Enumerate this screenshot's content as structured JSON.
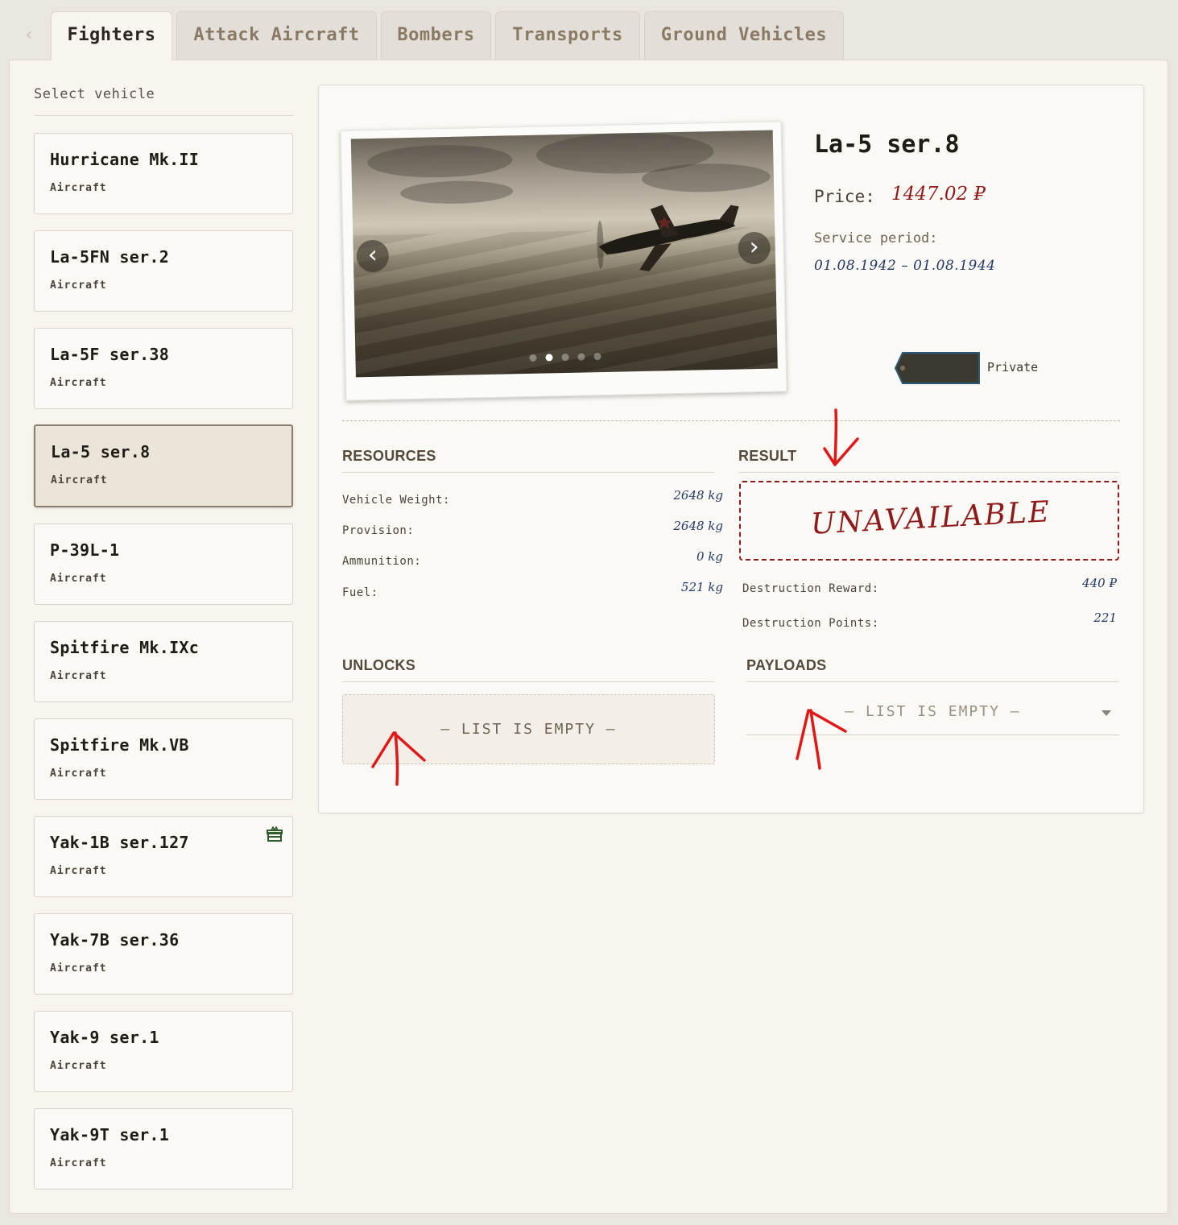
{
  "tabs": [
    {
      "label": "Fighters",
      "active": true
    },
    {
      "label": "Attack Aircraft"
    },
    {
      "label": "Bombers"
    },
    {
      "label": "Transports"
    },
    {
      "label": "Ground Vehicles"
    }
  ],
  "back_icon": "chevron-left-icon",
  "sidebar": {
    "title": "Select vehicle",
    "vehicles": [
      {
        "name": "Hurricane Mk.II",
        "type": "Aircraft"
      },
      {
        "name": "La-5FN ser.2",
        "type": "Aircraft"
      },
      {
        "name": "La-5F ser.38",
        "type": "Aircraft"
      },
      {
        "name": "La-5 ser.8",
        "type": "Aircraft",
        "selected": true
      },
      {
        "name": "P-39L-1",
        "type": "Aircraft"
      },
      {
        "name": "Spitfire Mk.IXc",
        "type": "Aircraft"
      },
      {
        "name": "Spitfire Mk.VB",
        "type": "Aircraft"
      },
      {
        "name": "Yak-1B ser.127",
        "type": "Aircraft",
        "icon": "gift-icon"
      },
      {
        "name": "Yak-7B ser.36",
        "type": "Aircraft"
      },
      {
        "name": "Yak-9 ser.1",
        "type": "Aircraft"
      },
      {
        "name": "Yak-9T ser.1",
        "type": "Aircraft"
      }
    ]
  },
  "detail": {
    "title": "La-5 ser.8",
    "price_label": "Price:",
    "price_value": "1447.02 ₽",
    "service_label": "Service period:",
    "service_value": "01.08.1942 – 01.08.1944",
    "rank": "Private",
    "gallery": {
      "slides": 5,
      "active_index": 1
    }
  },
  "resources": {
    "title": "RESOURCES",
    "rows": [
      {
        "label": "Vehicle Weight:",
        "value": "2648 kg"
      },
      {
        "label": "Provision:",
        "value": "2648 kg"
      },
      {
        "label": "Ammunition:",
        "value": "0 kg"
      },
      {
        "label": "Fuel:",
        "value": "521 kg"
      }
    ]
  },
  "result": {
    "title": "RESULT",
    "status": "UNAVAILABLE",
    "rows": [
      {
        "label": "Destruction Reward:",
        "value": "440 ₽"
      },
      {
        "label": "Destruction Points:",
        "value": "221"
      }
    ]
  },
  "unlocks": {
    "title": "UNLOCKS",
    "empty_text": "— LIST IS EMPTY —"
  },
  "payloads": {
    "title": "PAYLOADS",
    "selected": "— LIST IS EMPTY —"
  },
  "colors": {
    "accent_red": "#8e1a1a",
    "ink_blue": "#233966",
    "annotation_red": "#e01818"
  }
}
